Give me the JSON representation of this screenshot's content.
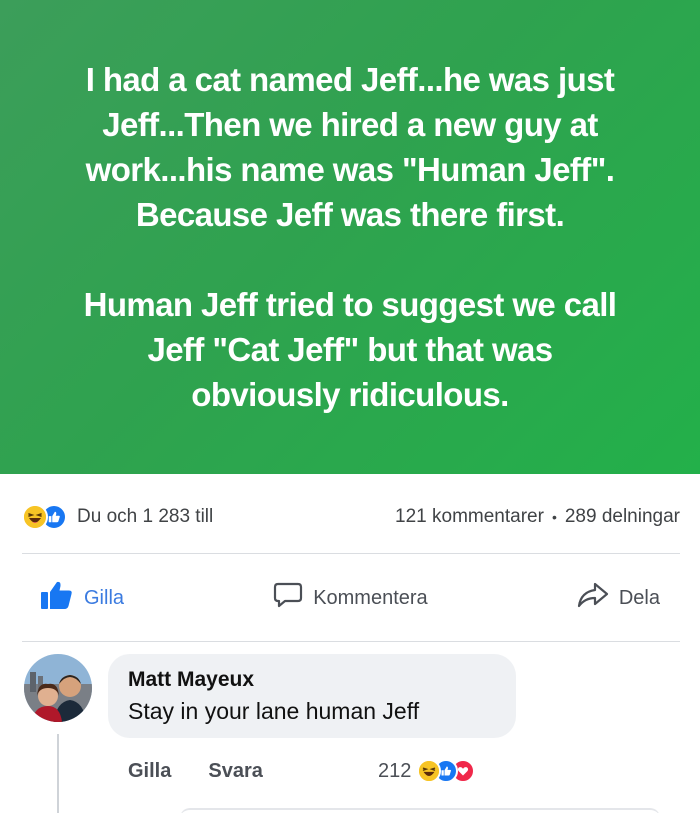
{
  "post": {
    "paragraph1": [
      "I had a cat named Jeff...he was just",
      "Jeff...Then we hired a new guy at",
      "work...his name was \"Human Jeff\".",
      "Because Jeff was there first."
    ],
    "paragraph2": [
      "Human Jeff tried to suggest we call",
      "Jeff \"Cat Jeff\" but that was",
      "obviously ridiculous."
    ],
    "background_color_start": "#3c9e5a",
    "background_color_end": "#23b04a"
  },
  "stats": {
    "reactions_text": "Du och 1 283 till",
    "comments_text": "121 kommentarer",
    "separator": "•",
    "shares_text": "289 delningar"
  },
  "actions": {
    "like_label": "Gilla",
    "comment_label": "Kommentera",
    "share_label": "Dela"
  },
  "comment": {
    "author": "Matt Mayeux",
    "text": "Stay in your lane human Jeff",
    "like_label": "Gilla",
    "reply_label": "Svara",
    "reaction_count": "212"
  },
  "colors": {
    "like_blue": "#1877f2",
    "haha_yellow": "#f7c425",
    "love_red": "#f0284a"
  }
}
